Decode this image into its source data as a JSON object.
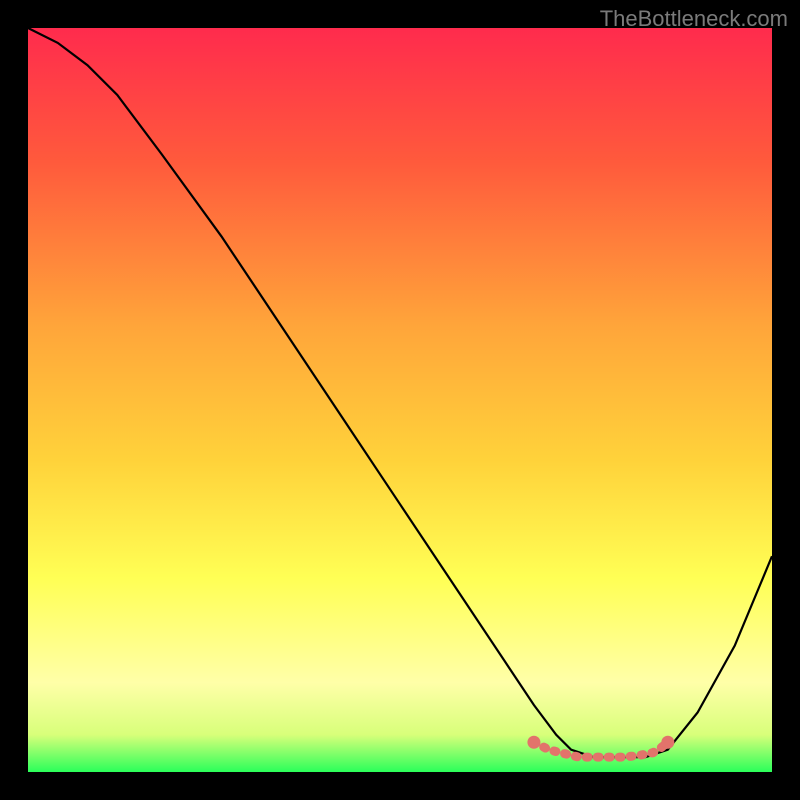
{
  "watermark": "TheBottleneck.com",
  "chart_data": {
    "type": "line",
    "title": "",
    "xlabel": "",
    "ylabel": "",
    "xlim": [
      0,
      100
    ],
    "ylim": [
      0,
      100
    ],
    "gradient_stops": [
      {
        "offset": 0,
        "color": "#ff2b4d"
      },
      {
        "offset": 18,
        "color": "#ff5a3c"
      },
      {
        "offset": 40,
        "color": "#ffa53a"
      },
      {
        "offset": 58,
        "color": "#ffd23a"
      },
      {
        "offset": 74,
        "color": "#ffff55"
      },
      {
        "offset": 88,
        "color": "#ffffa8"
      },
      {
        "offset": 95,
        "color": "#d8ff7a"
      },
      {
        "offset": 100,
        "color": "#2bff5a"
      }
    ],
    "series": [
      {
        "name": "bottleneck-curve",
        "color": "#000000",
        "x": [
          0,
          4,
          8,
          12,
          18,
          26,
          34,
          42,
          50,
          58,
          64,
          68,
          71,
          73,
          76,
          80,
          83,
          86,
          90,
          95,
          100
        ],
        "y": [
          100,
          98,
          95,
          91,
          83,
          72,
          60,
          48,
          36,
          24,
          15,
          9,
          5,
          3,
          2,
          2,
          2,
          3,
          8,
          17,
          29
        ]
      },
      {
        "name": "optimal-band",
        "color": "#e2736b",
        "style": "dotted-thick",
        "x": [
          68,
          70,
          72,
          74,
          76,
          78,
          80,
          82,
          84,
          85,
          86
        ],
        "y": [
          4,
          3,
          2.5,
          2,
          2,
          2,
          2,
          2.2,
          2.6,
          3.2,
          4
        ]
      }
    ]
  }
}
